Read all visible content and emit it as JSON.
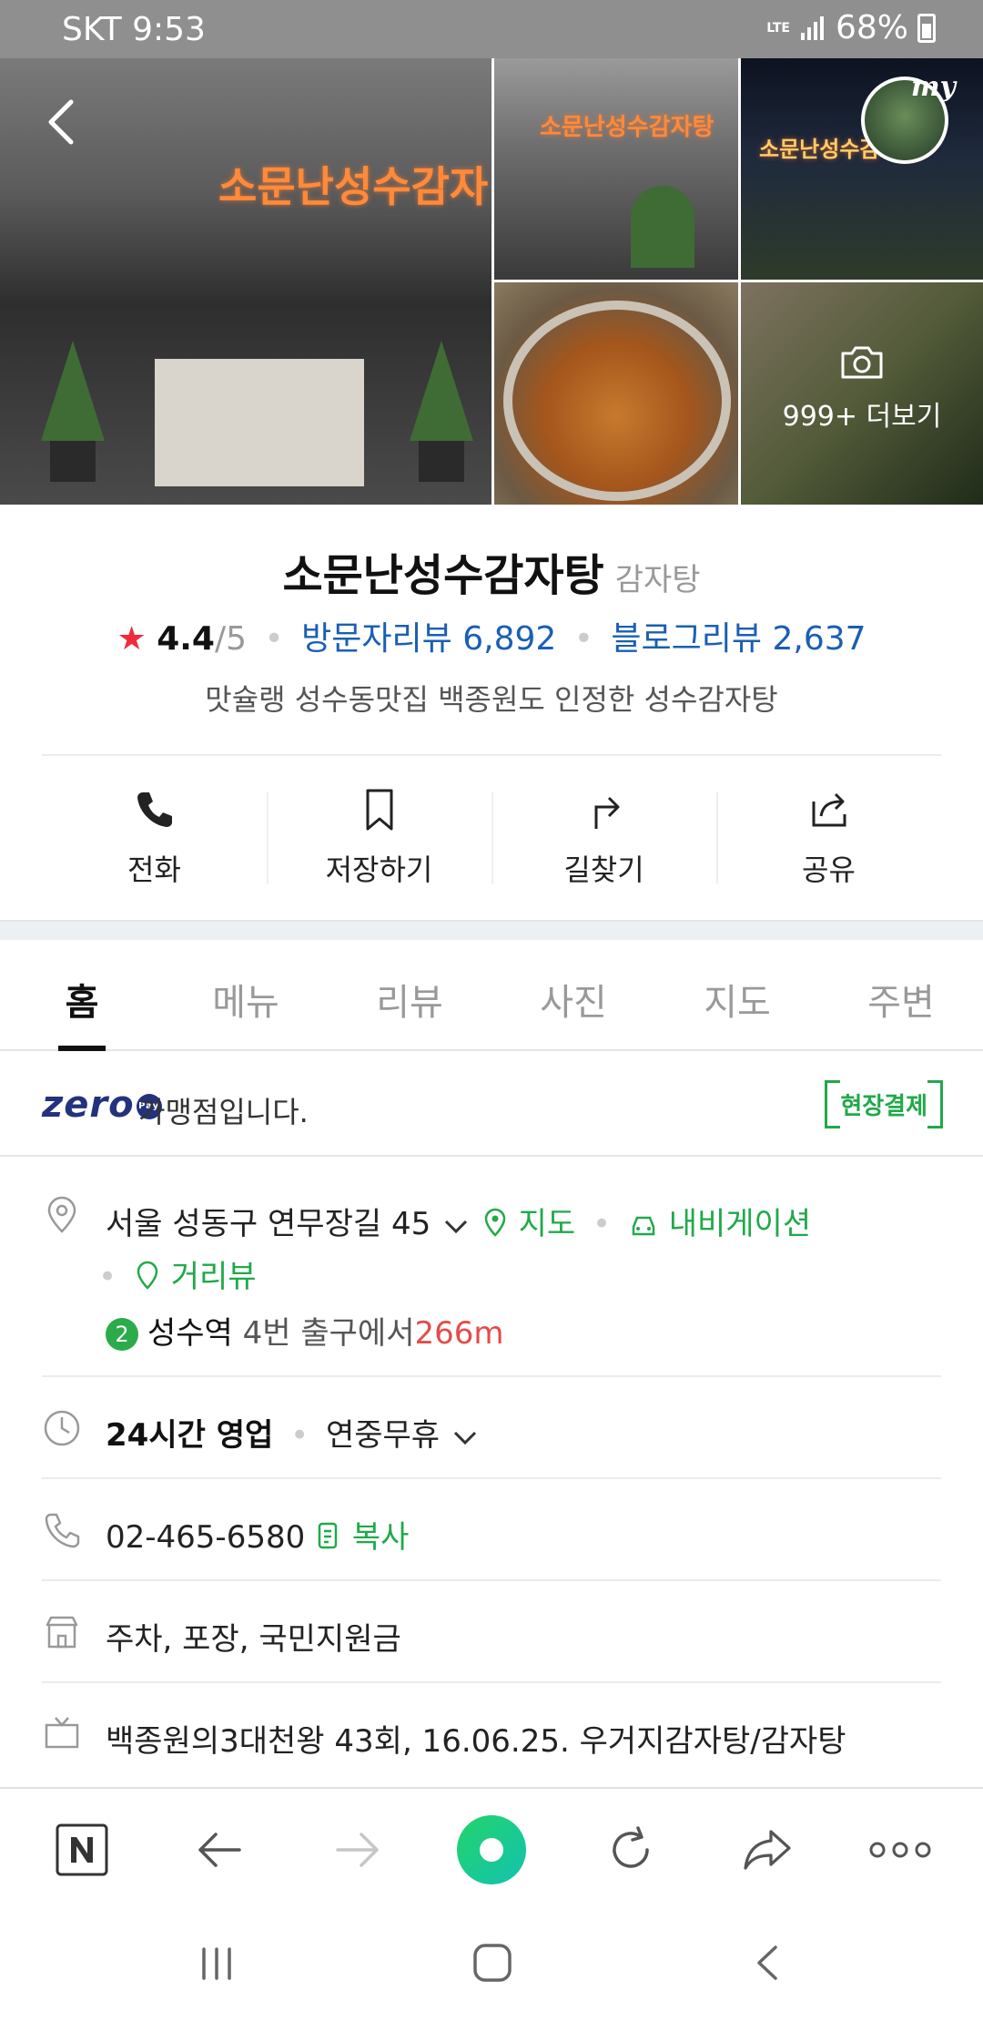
{
  "status_bar": {
    "carrier_time": "SKT 9:53",
    "network": "LTE",
    "battery": "68%"
  },
  "photos": {
    "more_label": "999+ 더보기",
    "my_label": "my",
    "sign_main": "소문난성수감자",
    "sign_thumb1": "소문난성수감자탕",
    "sign_thumb2": "소문난성수감자탕"
  },
  "place": {
    "name": "소문난성수감자탕",
    "category": "감자탕",
    "star": "★",
    "rating": "4.4",
    "rating_max": "/5",
    "visitor_reviews": "방문자리뷰 6,892",
    "blog_reviews": "블로그리뷰 2,637",
    "description": "맛슐랭 성수동맛집 백종원도 인정한 성수감자탕"
  },
  "actions": [
    {
      "label": "전화",
      "icon": "phone-icon"
    },
    {
      "label": "저장하기",
      "icon": "bookmark-icon"
    },
    {
      "label": "길찾기",
      "icon": "directions-icon"
    },
    {
      "label": "공유",
      "icon": "share-icon"
    }
  ],
  "tabs": [
    "홈",
    "메뉴",
    "리뷰",
    "사진",
    "지도",
    "주변"
  ],
  "zero_pay": {
    "logo": "zero",
    "pay": "Pay",
    "text": "가맹점입니다.",
    "onsite": "현장결제"
  },
  "address": {
    "text": "서울 성동구 연무장길 45",
    "map_link": "지도",
    "nav_link": "내비게이션",
    "street_link": "거리뷰",
    "line_no": "2",
    "station": "성수역",
    "exit_text": "4번 출구에서",
    "distance": "266m"
  },
  "hours": {
    "main": "24시간 영업",
    "sub": "연중무휴"
  },
  "phone": {
    "number": "02-465-6580",
    "copy": "복사"
  },
  "amenities": "주차, 포장, 국민지원금",
  "tv": "백종원의3대천왕 43회, 16.06.25. 우거지감자탕/감자탕",
  "colors": {
    "accent_green": "#21a94a",
    "link_blue": "#1a5fb4",
    "star_red": "#f02c3b",
    "zero_navy": "#23327c"
  }
}
